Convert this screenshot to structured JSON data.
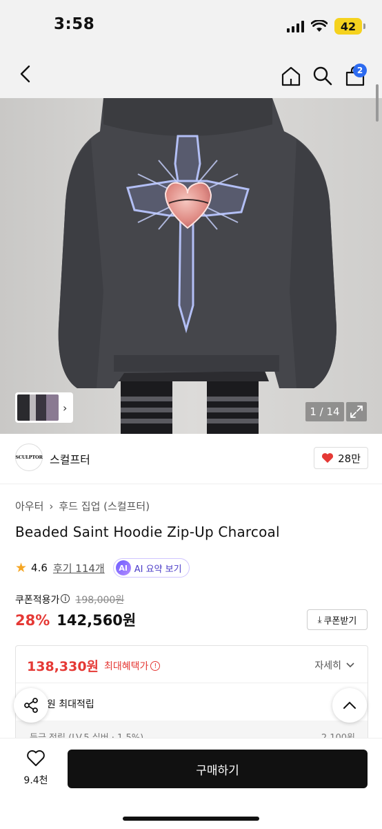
{
  "status": {
    "time": "3:58",
    "battery": "42"
  },
  "nav": {
    "cart_count": "2"
  },
  "gallery": {
    "counter": "1 / 14"
  },
  "brand": {
    "logo_text": "SCULPTOR",
    "name": "스컬프터",
    "likes": "28만"
  },
  "breadcrumb": {
    "category": "아우터",
    "subcategory": "후드 집업 (스컬프터)"
  },
  "product": {
    "title": "Beaded Saint Hoodie Zip-Up Charcoal",
    "rating": "4.6",
    "reviews": "후기 114개",
    "ai_summary": "AI 요약 보기",
    "ai_badge": "AI"
  },
  "price": {
    "coupon_label": "쿠폰적용가",
    "original": "198,000원",
    "discount": "28%",
    "sale": "142,560원",
    "coupon_button": "쿠폰받기"
  },
  "benefits": {
    "max_price": "138,330원",
    "max_label": "최대혜택가",
    "detail": "자세히",
    "points": "0원 최대적립",
    "sub_left": "등급 적립 (LV.5 실버 · 1.5%)",
    "sub_right": "2,100원"
  },
  "bottom": {
    "wish_count": "9.4천",
    "buy_label": "구매하기"
  }
}
